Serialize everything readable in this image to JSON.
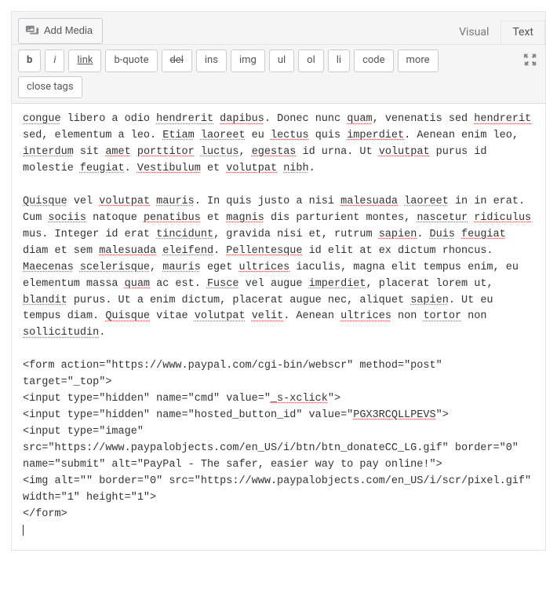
{
  "addMedia": {
    "label": "Add Media"
  },
  "tabs": {
    "visual": "Visual",
    "text": "Text"
  },
  "toolbar": {
    "b": "b",
    "i": "i",
    "link": "link",
    "bquote": "b-quote",
    "del": "del",
    "ins": "ins",
    "img": "img",
    "ul": "ul",
    "ol": "ol",
    "li": "li",
    "code": "code",
    "more": "more",
    "closeTags": "close tags"
  },
  "content": {
    "para1": {
      "w1": "congue",
      "t1": " libero a odio ",
      "w2": "hendrerit",
      "t2": " ",
      "w3": "dapibus",
      "t3": ". Donec nunc ",
      "w4": "quam",
      "t4": ", venenatis sed ",
      "w5": "hendrerit",
      "t5": " sed, elementum a leo. ",
      "w6": "Etiam",
      "t6": " ",
      "w7": "laoreet",
      "t7": " eu ",
      "w8": "lectus",
      "t8": " quis ",
      "w9": "imperdiet",
      "t9": ". Aenean enim leo, ",
      "w10": "interdum",
      "t10": " sit ",
      "w11": "amet",
      "t11": " ",
      "w12": "porttitor",
      "t12": " ",
      "w13": "luctus",
      "t13": ", ",
      "w14": "egestas",
      "t14": " id urna. Ut ",
      "w15": "volutpat",
      "t15": " purus id molestie ",
      "w16": "feugiat",
      "t16": ". ",
      "w17": "Vestibulum",
      "t17": " et ",
      "w18": "volutpat",
      "t18": " ",
      "w19": "nibh",
      "t19": "."
    },
    "para2": {
      "w1": "Quisque",
      "t1": " vel ",
      "w2": "volutpat",
      "t2": " ",
      "w3": "mauris",
      "t3": ". In quis justo a nisi ",
      "w4": "malesuada",
      "t4": " ",
      "w5": "laoreet",
      "t5": " in in erat. Cum ",
      "w6": "sociis",
      "t6": " natoque ",
      "w7": "penatibus",
      "t7": " et ",
      "w8": "magnis",
      "t8": " dis parturient montes, ",
      "w9": "nascetur",
      "t9": " ",
      "w10": "ridiculus",
      "t10": " mus. Integer id erat ",
      "w11": "tincidunt",
      "t11": ", gravida nisi et, rutrum ",
      "w12": "sapien",
      "t12": ". ",
      "w13": "Duis",
      "t13": " ",
      "w14": "feugiat",
      "t14": " diam et sem ",
      "w15": "malesuada",
      "t15": " ",
      "w16": "eleifend",
      "t16": ". ",
      "w17": "Pellentesque",
      "t17": " id elit at ex dictum rhoncus. ",
      "w18": "Maecenas",
      "t18": " ",
      "w19": "scelerisque",
      "t19": ", ",
      "w20": "mauris",
      "t20": " eget ",
      "w21": "ultrices",
      "t21": " iaculis, magna elit tempus enim, eu elementum massa ",
      "w22": "quam",
      "t22": " ac est. ",
      "w23": "Fusce",
      "t23": " vel augue ",
      "w24": "imperdiet",
      "t24": ", placerat lorem ut, ",
      "w25": "blandit",
      "t25": " purus. Ut a enim dictum, placerat augue nec, aliquet ",
      "w26": "sapien",
      "t26": ". Ut eu tempus diam. ",
      "w27": "Quisque",
      "t27": " vitae ",
      "w28": "volutpat",
      "t28": " ",
      "w29": "velit",
      "t29": ". Aenean ",
      "w30": "ultrices",
      "t30": " non ",
      "w31": "tortor",
      "t31": " non ",
      "w32": "sollicitudin",
      "t32": "."
    },
    "code": {
      "l1a": "<form action=\"https://www.paypal.com/cgi-bin/webscr\" method=\"post\" target=\"_top\">",
      "l2a": "<input type=\"hidden\" name=\"cmd\" value=\"",
      "l2sp": "_s-xclick",
      "l2b": "\">",
      "l3a": "<input type=\"hidden\" name=\"hosted_button_id\" value=\"",
      "l3sp": "PGX3RCQLLPEVS",
      "l3b": "\">",
      "l4": "<input type=\"image\" src=\"https://www.paypalobjects.com/en_US/i/btn/btn_donateCC_LG.gif\" border=\"0\" name=\"submit\" alt=\"PayPal - The safer, easier way to pay online!\">",
      "l5": "<img alt=\"\" border=\"0\" src=\"https://www.paypalobjects.com/en_US/i/scr/pixel.gif\" width=\"1\" height=\"1\">",
      "l6": "</form>"
    }
  }
}
